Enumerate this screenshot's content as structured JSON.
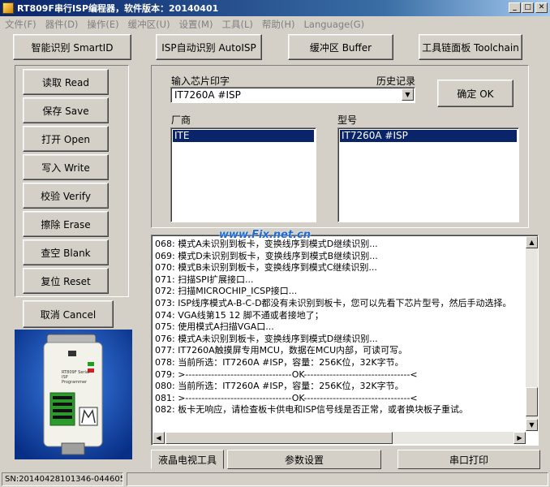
{
  "window": {
    "title": "RT809F串行ISP编程器，软件版本：20140401"
  },
  "menu": [
    "文件(F)",
    "器件(D)",
    "操作(E)",
    "缓冲区(U)",
    "设置(M)",
    "工具(L)",
    "帮助(H)",
    "Language(G)"
  ],
  "toolbar": {
    "smartid": "智能识别 SmartID",
    "autoisp": "ISP自动识别 AutoISP",
    "buffer": "缓冲区 Buffer",
    "toolchain": "工具链面板 Toolchain"
  },
  "ops": [
    "读取 Read",
    "保存 Save",
    "打开 Open",
    "写入 Write",
    "校验 Verify",
    "擦除 Erase",
    "查空 Blank",
    "复位 Reset"
  ],
  "cancel": "取消 Cancel",
  "chip": {
    "input_label": "输入芯片印字",
    "history_label": "历史记录",
    "combo_value": "IT7260A #ISP",
    "ok_button": "确定 OK",
    "vendor_label": "厂商",
    "model_label": "型号",
    "vendor_selected": "ITE",
    "model_selected": "IT7260A #ISP"
  },
  "log": [
    "068: 模式A未识别到板卡，变换线序到模式D继续识别...",
    "069: 模式D未识别到板卡，变换线序到模式B继续识别...",
    "070: 模式B未识别到板卡，变换线序到模式C继续识别...",
    "071: 扫描SPI扩展接口...",
    "072: 扫描MICROCHIP_ICSP接口...",
    "073: ISP线序模式A-B-C-D都没有未识别到板卡，您可以先看下芯片型号，然后手动选择。",
    "074: VGA线第15 12 脚不通或者接地了；",
    "075: 使用模式A扫描VGA口...",
    "076: 模式A未识别到板卡，变换线序到模式D继续识别...",
    "077: IT7260A触摸屏专用MCU，数据在MCU内部，可读可写。",
    "078: 当前所选：IT7260A #ISP，容量：256K位，32K字节。",
    "079: >---------------------------------OK---------------------------------<",
    "080: 当前所选：IT7260A #ISP，容量：256K位，32K字节。",
    "081: >---------------------------------OK---------------------------------<",
    "082: 板卡无响应，请检查板卡供电和ISP信号线是否正常，或者换块板子重试。"
  ],
  "watermark": "www.Fix.net.cn",
  "tabs": [
    "液晶电视工具",
    "参数设置",
    "串口打印"
  ],
  "status": {
    "sn": "SN:20140428101346-044605"
  },
  "device": {
    "label": "RT809F Serial ISP Programmer"
  }
}
